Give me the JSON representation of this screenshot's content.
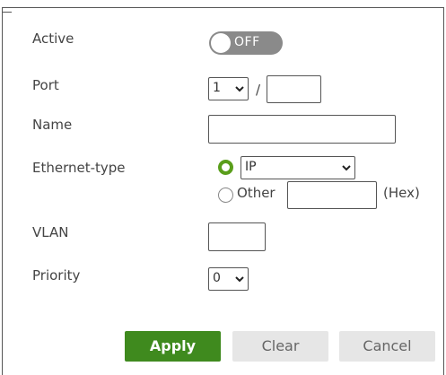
{
  "form": {
    "active": {
      "label": "Active",
      "toggle_text": "OFF"
    },
    "port": {
      "label": "Port",
      "slot": "1",
      "separator": "/",
      "port_value": ""
    },
    "name": {
      "label": "Name",
      "value": ""
    },
    "ethernet_type": {
      "label": "Ethernet-type",
      "ip_option": "IP",
      "other_label": "Other",
      "other_value": "",
      "hex_label": "(Hex)",
      "selected": "IP"
    },
    "vlan": {
      "label": "VLAN",
      "value": ""
    },
    "priority": {
      "label": "Priority",
      "value": "0"
    }
  },
  "buttons": {
    "apply": "Apply",
    "clear": "Clear",
    "cancel": "Cancel"
  },
  "colors": {
    "accent": "#3f8a1e",
    "radio": "#5a9e1b",
    "toggle_off": "#8a8a8a"
  },
  "icons": {
    "dropdown": "chevron-down-icon"
  }
}
